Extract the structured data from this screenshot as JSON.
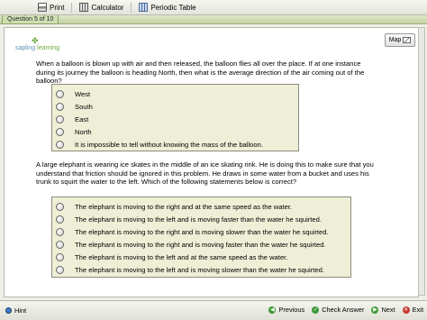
{
  "toolbar": {
    "print_label": "Print",
    "calculator_label": "Calculator",
    "periodic_table_label": "Periodic Table"
  },
  "question_tab": "Question 5 of 10",
  "logo": {
    "part1": "sapling",
    "part2": "learning"
  },
  "map_button": "Map",
  "question1": {
    "text": "When a balloon is blown up with air and then released, the balloon flies all over the place. If at one instance during its journey the balloon is heading North, then what is the average direction of the air coming out of the balloon?",
    "options": [
      "West",
      "South",
      "East",
      "North",
      "It is impossible to tell without knowing the mass of the balloon."
    ]
  },
  "question2": {
    "text": "A large elephant is wearing ice skates in the middle of an ice skating rink. He is doing this to make sure that you understand that friction should be ignored in this problem. He draws in some water from a bucket and uses his trunk to squirt the water to the left. Which of the following statements below is correct?",
    "options": [
      "The elephant is moving to the right and at the same speed as the water.",
      "The elephant is moving to the left and is moving faster than the water he squirted.",
      "The elephant is moving to the right and is moving slower than the water he squirted.",
      "The elephant is moving to the right and is moving faster than the water he squirted.",
      "The elephant is moving to the left and at the same speed as the water.",
      "The elephant is moving to the left and is moving slower than the water he squirted."
    ]
  },
  "footer": {
    "hint_label": "Hint",
    "previous_label": "Previous",
    "check_answer_label": "Check Answer",
    "next_label": "Next",
    "exit_label": "Exit"
  }
}
